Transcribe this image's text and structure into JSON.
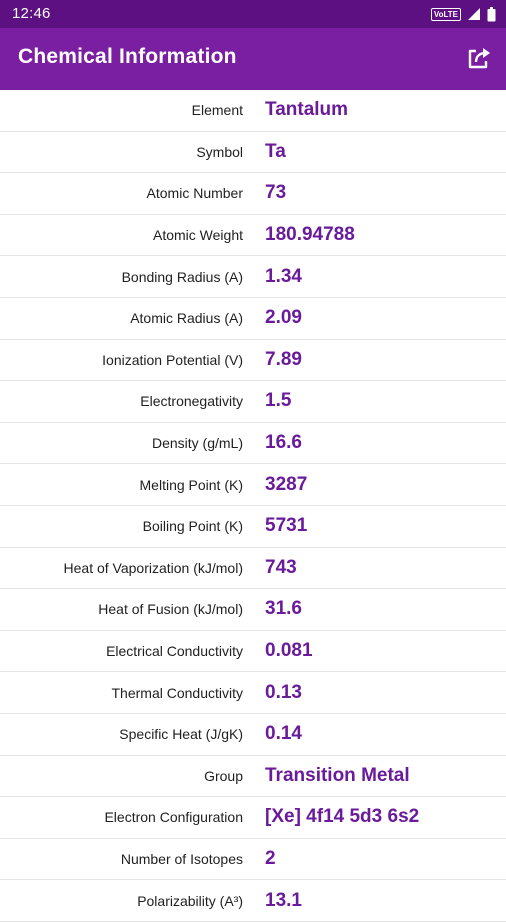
{
  "status_bar": {
    "time": "12:46",
    "network_badge": "VoLTE",
    "icons": [
      "signal-icon",
      "battery-icon"
    ]
  },
  "app_bar": {
    "title": "Chemical Information",
    "share_icon": "share-icon"
  },
  "colors": {
    "status_bar": "#5d1082",
    "app_bar": "#7b1fa2",
    "value_text": "#6a1b9a"
  },
  "properties": [
    {
      "label": "Element",
      "value": "Tantalum"
    },
    {
      "label": "Symbol",
      "value": "Ta"
    },
    {
      "label": "Atomic Number",
      "value": "73"
    },
    {
      "label": "Atomic Weight",
      "value": "180.94788"
    },
    {
      "label": "Bonding Radius (A)",
      "value": "1.34"
    },
    {
      "label": "Atomic Radius (A)",
      "value": "2.09"
    },
    {
      "label": "Ionization Potential (V)",
      "value": "7.89"
    },
    {
      "label": "Electronegativity",
      "value": "1.5"
    },
    {
      "label": "Density (g/mL)",
      "value": "16.6"
    },
    {
      "label": "Melting Point (K)",
      "value": "3287"
    },
    {
      "label": "Boiling Point (K)",
      "value": "5731"
    },
    {
      "label": "Heat of Vaporization (kJ/mol)",
      "value": "743"
    },
    {
      "label": "Heat of Fusion (kJ/mol)",
      "value": "31.6"
    },
    {
      "label": "Electrical Conductivity",
      "value": "0.081"
    },
    {
      "label": "Thermal Conductivity",
      "value": "0.13"
    },
    {
      "label": "Specific Heat (J/gK)",
      "value": "0.14"
    },
    {
      "label": "Group",
      "value": "Transition Metal"
    },
    {
      "label": "Electron Configuration",
      "value": "[Xe] 4f14 5d3 6s2"
    },
    {
      "label": "Number of Isotopes",
      "value": "2"
    },
    {
      "label": "Polarizability (A³)",
      "value": "13.1"
    }
  ]
}
